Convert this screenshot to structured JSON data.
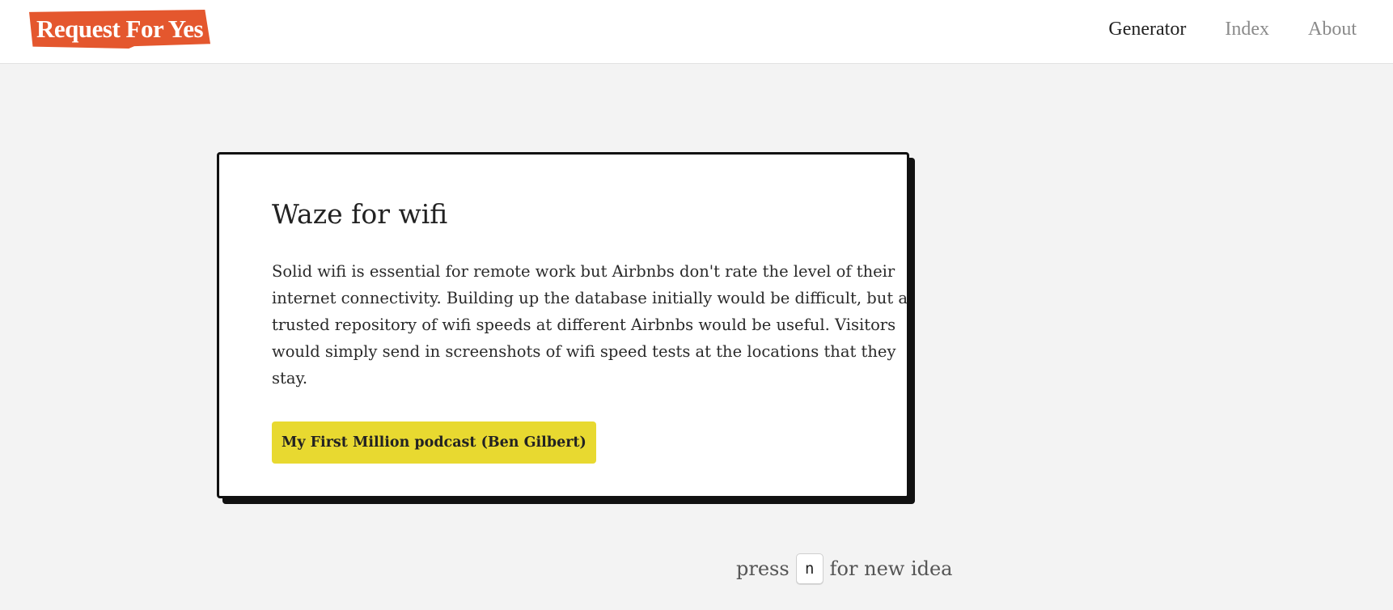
{
  "header": {
    "logo_text": "Request For Yes",
    "nav": [
      {
        "label": "Generator",
        "active": true
      },
      {
        "label": "Index",
        "active": false
      },
      {
        "label": "About",
        "active": false
      }
    ]
  },
  "idea": {
    "title": "Waze for wifi",
    "description": "Solid wifi is essential for remote work but Airbnbs don't rate the level of their internet connectivity. Building up the database initially would be difficult, but a trusted repository of wifi speeds at different Airbnbs would be useful. Visitors would simply send in screenshots of wifi speed tests at the locations that they stay.",
    "source_label": "My First Million podcast (Ben Gilbert)"
  },
  "hint": {
    "prefix": "press",
    "key": "n",
    "suffix": "for new idea"
  },
  "colors": {
    "logo_bg": "#e4572e",
    "source_button_bg": "#e8d930",
    "card_border": "#111111",
    "page_bg": "#f3f3f3"
  }
}
